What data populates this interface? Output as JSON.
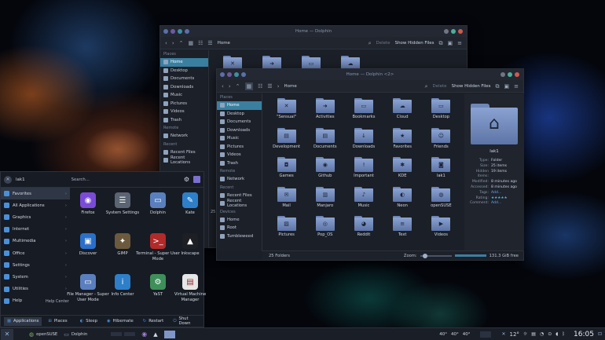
{
  "colors": {
    "accent": "#3a7fa0",
    "folder": "#7f96c8",
    "close": "#d1584f",
    "max": "#4caf9a",
    "min": "#b08b3a"
  },
  "back_window": {
    "title": "Home — Dolphin",
    "breadcrumb": "Home",
    "delete_label": "Delete",
    "hidden_label": "Show Hidden Files",
    "places_header": "Places",
    "places": [
      "Home",
      "Desktop",
      "Documents",
      "Downloads",
      "Music",
      "Pictures",
      "Videos",
      "Trash"
    ],
    "remote_header": "Remote",
    "remote": [
      "Network"
    ],
    "recent_header": "Recent",
    "recent": [
      "Recent Files",
      "Recent Locations"
    ],
    "status_fragment": "25 F"
  },
  "front_window": {
    "title": "Home — Dolphin <2>",
    "breadcrumb": "Home",
    "delete_label": "Delete",
    "hidden_label": "Show Hidden Files",
    "places_header": "Places",
    "places": [
      "Home",
      "Desktop",
      "Documents",
      "Downloads",
      "Music",
      "Pictures",
      "Videos",
      "Trash"
    ],
    "remote_header": "Remote",
    "remote": [
      "Network"
    ],
    "recent_header": "Recent",
    "recent": [
      "Recent Files",
      "Recent Locations"
    ],
    "devices_header": "Devices",
    "devices": [
      "Home",
      "Root",
      "Tumbleweed"
    ],
    "files": [
      {
        "name": "\"Sensual\"",
        "icon": "kde-crossed-icon"
      },
      {
        "name": "Activities",
        "icon": "activities-icon"
      },
      {
        "name": "Bookmarks",
        "icon": "bookmark-icon"
      },
      {
        "name": "Cloud",
        "icon": "cloud-icon"
      },
      {
        "name": "Desktop",
        "icon": "desktop-icon"
      },
      {
        "name": "Development",
        "icon": "development-icon"
      },
      {
        "name": "Documents",
        "icon": "document-icon"
      },
      {
        "name": "Downloads",
        "icon": "download-icon"
      },
      {
        "name": "Favorites",
        "icon": "star-icon"
      },
      {
        "name": "Friends",
        "icon": "people-icon"
      },
      {
        "name": "Games",
        "icon": "gamepad-icon"
      },
      {
        "name": "Github",
        "icon": "github-icon"
      },
      {
        "name": "Important",
        "icon": "exclamation-icon"
      },
      {
        "name": "KDE",
        "icon": "kde-icon"
      },
      {
        "name": "lak1",
        "icon": "user-folder-icon"
      },
      {
        "name": "Mail",
        "icon": "mail-icon"
      },
      {
        "name": "Manjaro",
        "icon": "manjaro-icon"
      },
      {
        "name": "Music",
        "icon": "music-icon"
      },
      {
        "name": "Neon",
        "icon": "neon-icon"
      },
      {
        "name": "openSUSE",
        "icon": "opensuse-icon"
      },
      {
        "name": "Pictures",
        "icon": "picture-icon"
      },
      {
        "name": "Pop_OS",
        "icon": "popos-icon"
      },
      {
        "name": "Reddit",
        "icon": "reddit-icon"
      },
      {
        "name": "Text",
        "icon": "text-icon"
      },
      {
        "name": "Videos",
        "icon": "video-icon"
      }
    ],
    "status_count": "25 Folders",
    "zoom_label": "Zoom:",
    "free_space": "131.3 GiB free",
    "info": {
      "name": "lak1",
      "rows": [
        {
          "k": "Type:",
          "v": "Folder"
        },
        {
          "k": "Size:",
          "v": "25 items"
        },
        {
          "k": "Hidden items:",
          "v": "19 items"
        },
        {
          "k": "Modified:",
          "v": "8 minutes ago"
        },
        {
          "k": "Accessed:",
          "v": "8 minutes ago"
        },
        {
          "k": "Tags:",
          "v": "Add..."
        },
        {
          "k": "Rating:",
          "v": "★★★★★"
        },
        {
          "k": "Comment:",
          "v": "Add..."
        }
      ]
    }
  },
  "launcher": {
    "user": "lak1",
    "search_placeholder": "Search...",
    "categories": [
      {
        "label": "Favorites",
        "color": "#4a90d9"
      },
      {
        "label": "All Applications",
        "color": "#4a90d9"
      },
      {
        "label": "Graphics",
        "color": "#4a90d9"
      },
      {
        "label": "Internet",
        "color": "#4a90d9"
      },
      {
        "label": "Multimedia",
        "color": "#4a90d9"
      },
      {
        "label": "Office",
        "color": "#4a90d9"
      },
      {
        "label": "Settings",
        "color": "#4a90d9"
      },
      {
        "label": "System",
        "color": "#4a90d9"
      },
      {
        "label": "Utilities",
        "color": "#4a90d9"
      },
      {
        "label": "Help",
        "color": "#4a90d9"
      }
    ],
    "help_center": "Help Center",
    "apps": [
      {
        "label": "Firefox",
        "color": "#7a4bd6",
        "glyph": "◉",
        "icon": "firefox-icon"
      },
      {
        "label": "System Settings",
        "color": "#5b6472",
        "glyph": "☰",
        "icon": "settings-icon"
      },
      {
        "label": "Dolphin",
        "color": "#5a7fbf",
        "glyph": "▭",
        "icon": "dolphin-icon"
      },
      {
        "label": "Kate",
        "color": "#2d7fc9",
        "glyph": "✎",
        "icon": "kate-icon"
      },
      {
        "label": "Discover",
        "color": "#2a6fc9",
        "glyph": "▣",
        "icon": "discover-icon"
      },
      {
        "label": "GIMP",
        "color": "#6b5a3e",
        "glyph": "✦",
        "icon": "gimp-icon"
      },
      {
        "label": "Terminal - Super User Mode",
        "color": "#b22a2a",
        "glyph": ">_",
        "icon": "terminal-icon"
      },
      {
        "label": "Inkscape",
        "color": "#1d1f24",
        "glyph": "▲",
        "icon": "inkscape-icon"
      },
      {
        "label": "File Manager - Super User Mode",
        "color": "#5a7fbf",
        "glyph": "▭",
        "icon": "file-manager-icon"
      },
      {
        "label": "Info Center",
        "color": "#2d7fc9",
        "glyph": "i",
        "icon": "info-icon"
      },
      {
        "label": "YaST",
        "color": "#3f8f5a",
        "glyph": "⚙",
        "icon": "yast-icon"
      },
      {
        "label": "Virtual Machine Manager",
        "color": "#e6e6e6",
        "glyph": "▤",
        "icon": "vm-icon"
      }
    ],
    "tabs": {
      "applications": "Applications",
      "places": "Places"
    },
    "power": {
      "sleep": "Sleep",
      "hibernate": "Hibernate",
      "restart": "Restart",
      "shutdown": "Shut Down"
    }
  },
  "panel": {
    "tasks": [
      "openSUSE",
      "Dolphin"
    ],
    "temps": [
      "40°",
      "40°",
      "40°"
    ],
    "weather": "12°",
    "clock": "16:05"
  }
}
